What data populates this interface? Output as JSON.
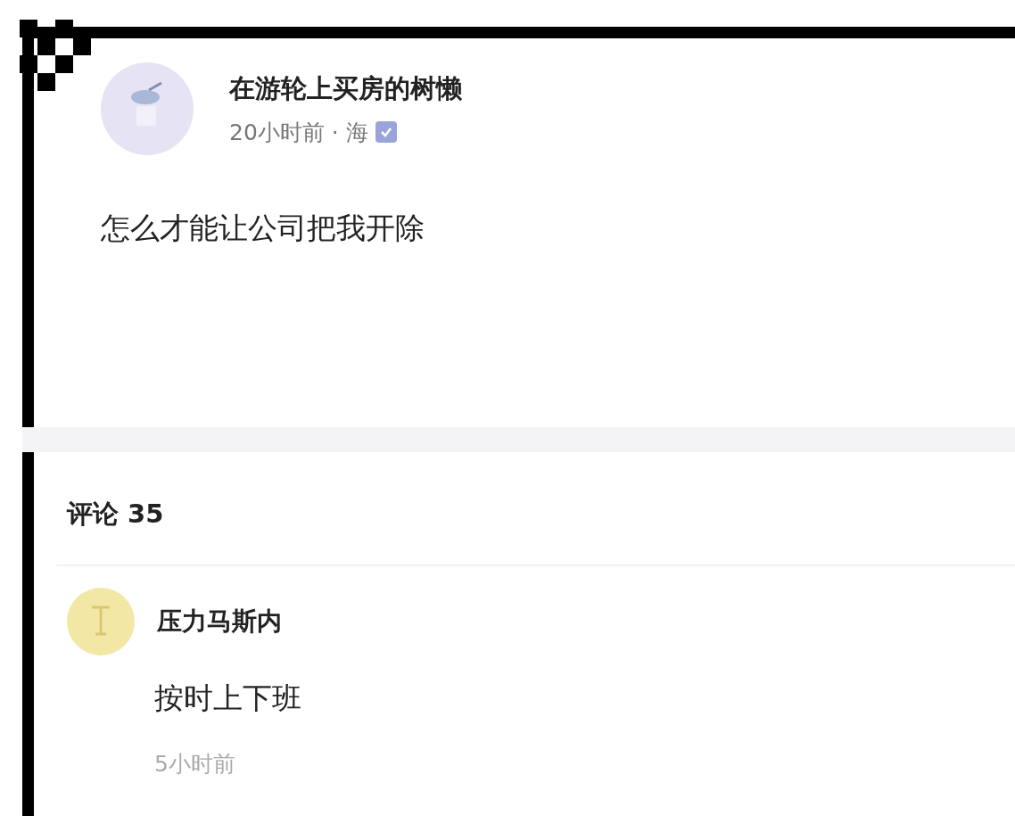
{
  "post": {
    "author": "在游轮上买房的树懒",
    "meta": "20小时前 · 海",
    "verified": true,
    "text": "怎么才能让公司把我开除"
  },
  "comments_header": {
    "label": "评论",
    "count": "35"
  },
  "comments": [
    {
      "author": "压力马斯内",
      "text": "按时上下班",
      "time": "5小时前"
    }
  ]
}
